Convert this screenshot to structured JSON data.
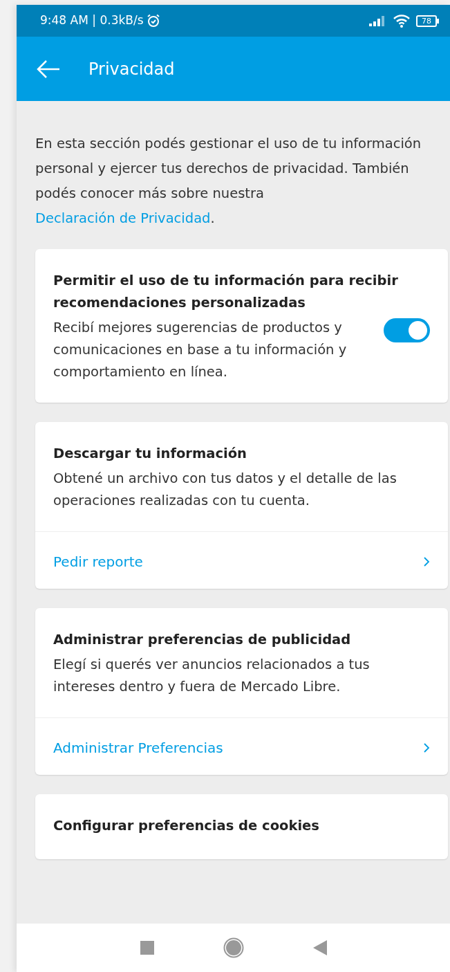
{
  "status_bar": {
    "time": "9:48 AM | 0.3kB/s",
    "battery": "78"
  },
  "app_bar": {
    "title": "Privacidad"
  },
  "intro": {
    "text": "En esta sección podés gestionar el uso de tu información personal y ejercer tus derechos de privacidad. También podés conocer más sobre nuestra ",
    "link": "Declaración de Privacidad",
    "after": "."
  },
  "cards": [
    {
      "kind": "toggle",
      "title": "Permitir el uso de tu información para recibir recomendaciones personalizadas",
      "description": "Recibí mejores sugerencias de productos y comunicaciones en base a tu información y comportamiento en línea.",
      "on": true
    },
    {
      "kind": "action",
      "title": "Descargar tu información",
      "description": "Obtené un archivo con tus datos y el detalle de las operaciones realizadas con tu cuenta.",
      "action": "Pedir reporte"
    },
    {
      "kind": "action",
      "title": "Administrar preferencias de publicidad",
      "description": "Elegí si querés ver anuncios relacionados a tus intereses dentro y fuera de Mercado Libre.",
      "action": "Administrar Preferencias"
    },
    {
      "kind": "title",
      "title": "Configurar preferencias de cookies"
    }
  ]
}
